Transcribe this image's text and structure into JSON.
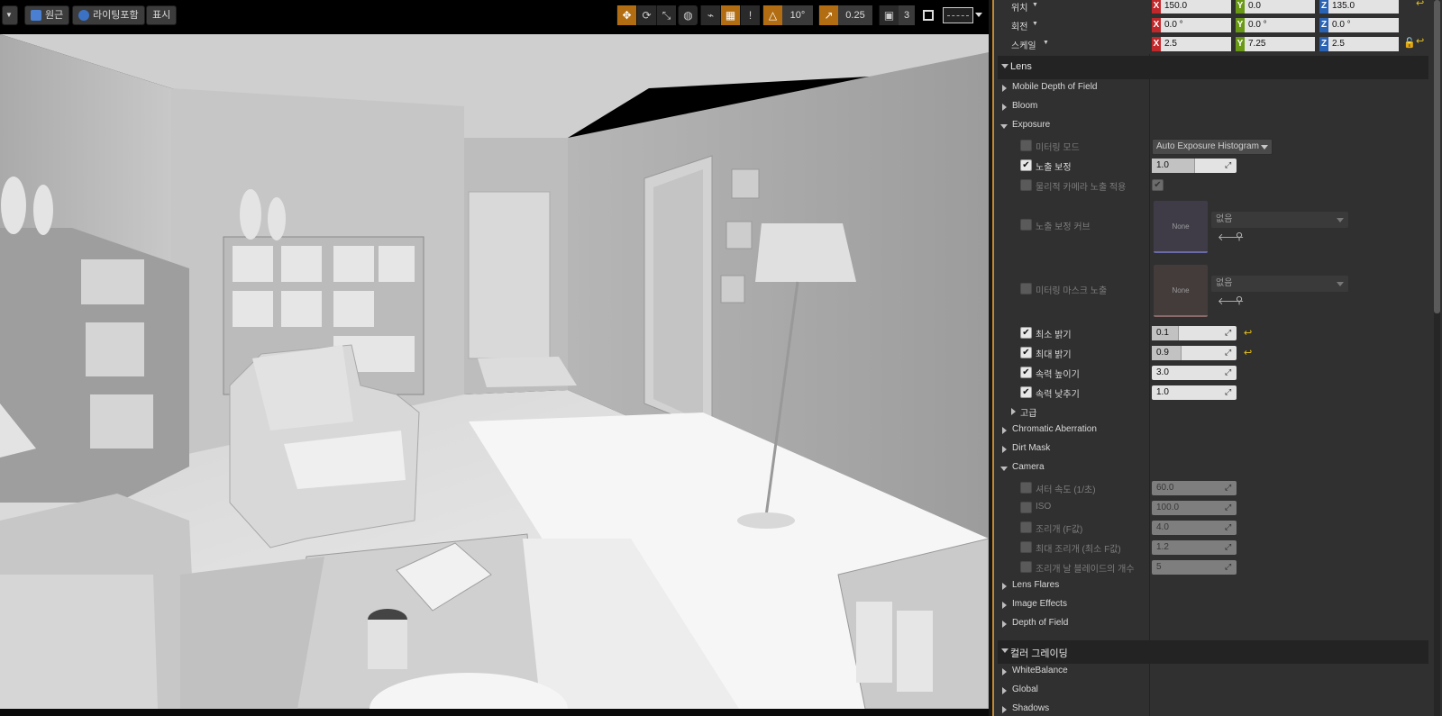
{
  "toolbar": {
    "view_mode_label": "원근",
    "lighting_label": "라이팅포함",
    "show_label": "표시",
    "grid_snap_value": "10°",
    "scale_snap_value": "0.25",
    "camera_speed_value": "3"
  },
  "transform": {
    "location_label": "위치",
    "rotation_label": "회전",
    "scale_label": "스케일",
    "location": {
      "x": "150.0",
      "y": "0.0",
      "z": "135.0"
    },
    "rotation": {
      "x": "0.0 °",
      "y": "0.0 °",
      "z": "0.0 °"
    },
    "scale": {
      "x": "2.5",
      "y": "7.25",
      "z": "2.5"
    }
  },
  "lens": {
    "title": "Lens",
    "mobile_dof": "Mobile Depth of Field",
    "bloom": "Bloom",
    "exposure": "Exposure",
    "metering_mode_label": "미터링 모드",
    "metering_mode_value": "Auto Exposure Histogram",
    "exposure_comp_label": "노출 보정",
    "exposure_comp_value": "1.0",
    "apply_physical_label": "물리적 카메라 노출 적용",
    "exposure_curve_label": "노출 보정 커브",
    "curve_thumb_text": "None",
    "curve_select": "없음",
    "metering_mask_label": "미터링 마스크 노출",
    "mask_thumb_text": "None",
    "mask_select": "없음",
    "min_brightness_label": "최소 밝기",
    "min_brightness_value": "0.1",
    "max_brightness_label": "최대 밝기",
    "max_brightness_value": "0.9",
    "speed_up_label": "속력 높이기",
    "speed_up_value": "3.0",
    "speed_down_label": "속력 낮추기",
    "speed_down_value": "1.0",
    "advanced_label": "고급",
    "chromatic": "Chromatic Aberration",
    "dirt_mask": "Dirt Mask",
    "camera": "Camera",
    "shutter_label": "셔터 속도 (1/초)",
    "shutter_value": "60.0",
    "iso_label": "ISO",
    "iso_value": "100.0",
    "aperture_label": "조리개 (F값)",
    "aperture_value": "4.0",
    "max_aperture_label": "최대 조리개 (최소 F값)",
    "max_aperture_value": "1.2",
    "blades_label": "조리개 날 블레이드의 개수",
    "blades_value": "5",
    "lens_flares": "Lens Flares",
    "image_effects": "Image Effects",
    "dof": "Depth of Field"
  },
  "color_grading": {
    "title": "컬러 그레이딩",
    "white_balance": "WhiteBalance",
    "global": "Global",
    "shadows": "Shadows"
  },
  "colors": {
    "accent_orange": "#c0892f",
    "reset_yellow": "#e8c21b",
    "axis_x": "#c1282b",
    "axis_y": "#6a9a15",
    "axis_z": "#2a63b3"
  }
}
